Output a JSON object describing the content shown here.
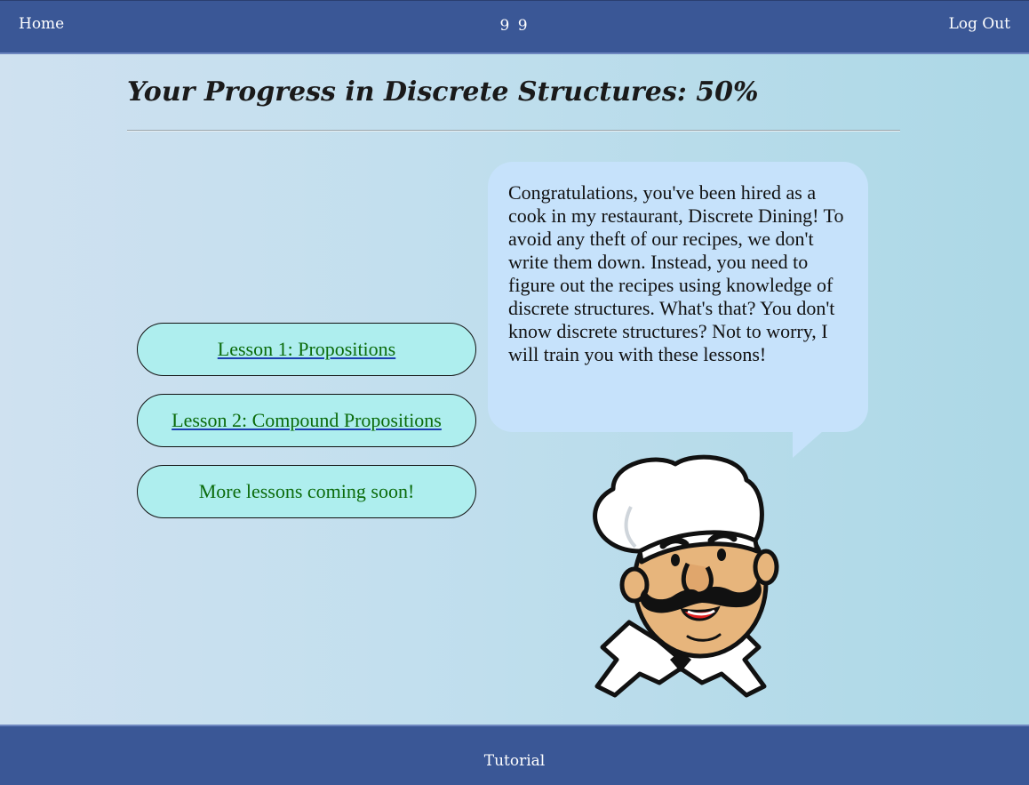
{
  "topbar": {
    "home_label": "Home",
    "center_text": "9 9",
    "logout_label": "Log Out"
  },
  "page": {
    "title": "Your Progress in Discrete Structures: 50%",
    "progress_percent": 50
  },
  "lessons": [
    {
      "label": "Lesson 1: Propositions"
    },
    {
      "label": "Lesson 2: Compound Propositions"
    },
    {
      "label": "More lessons coming soon!"
    }
  ],
  "speech": {
    "text": "Congratulations, you've been hired as a cook in my restaurant, Discrete Dining! To avoid any theft of our recipes, we don't write them down. Instead, you need to figure out the recipes using knowledge of discrete structures. What's that? You don't know discrete structures? Not to worry, I will train you with these lessons!"
  },
  "mascot": {
    "icon": "chef-mascot-icon"
  },
  "footer": {
    "tutorial_label": "Tutorial"
  },
  "colors": {
    "nav_bg": "#3a5796",
    "button_bg": "#aeeeee",
    "button_text": "#0b6b0b",
    "bubble_bg": "#c6e2fb"
  }
}
